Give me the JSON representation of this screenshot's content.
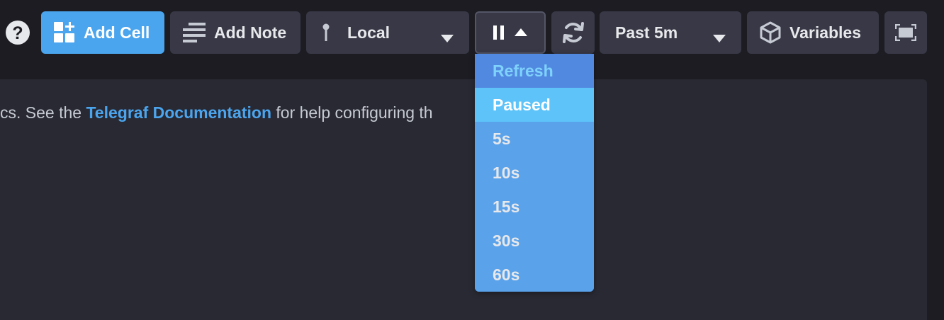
{
  "toolbar": {
    "help_icon": "question-circle-icon",
    "add_cell": {
      "label": "Add Cell",
      "icon": "add-cell-icon",
      "color": "#4ba5ee"
    },
    "add_note": {
      "label": "Add Note",
      "icon": "note-lines-icon"
    },
    "bucket": {
      "label": "Local",
      "icon": "pin-icon"
    },
    "autorefresh": {
      "icons": [
        "pause-icon",
        "caret-up-icon"
      ]
    },
    "refresh": {
      "icon": "refresh-icon"
    },
    "time_range": {
      "label": "Past 5m"
    },
    "variables": {
      "label": "Variables",
      "icon": "cube-icon"
    },
    "presentation": {
      "icon": "presentation-mode-icon"
    }
  },
  "content": {
    "text_prefix": "cs. See the ",
    "link": "Telegraf Documentation",
    "text_suffix": " for help configuring th"
  },
  "refresh_dropdown": {
    "header": "Refresh",
    "selected": "Paused",
    "options": [
      "Paused",
      "5s",
      "10s",
      "15s",
      "30s",
      "60s"
    ]
  },
  "colors": {
    "background": "#1c1c22",
    "button": "#383846",
    "panel": "#292933",
    "accent": "#4ba5ee",
    "dropdown": "#5aa2ea",
    "dropdown_selected": "#5dc3f9",
    "dropdown_header_text": "#7ed2fb"
  }
}
